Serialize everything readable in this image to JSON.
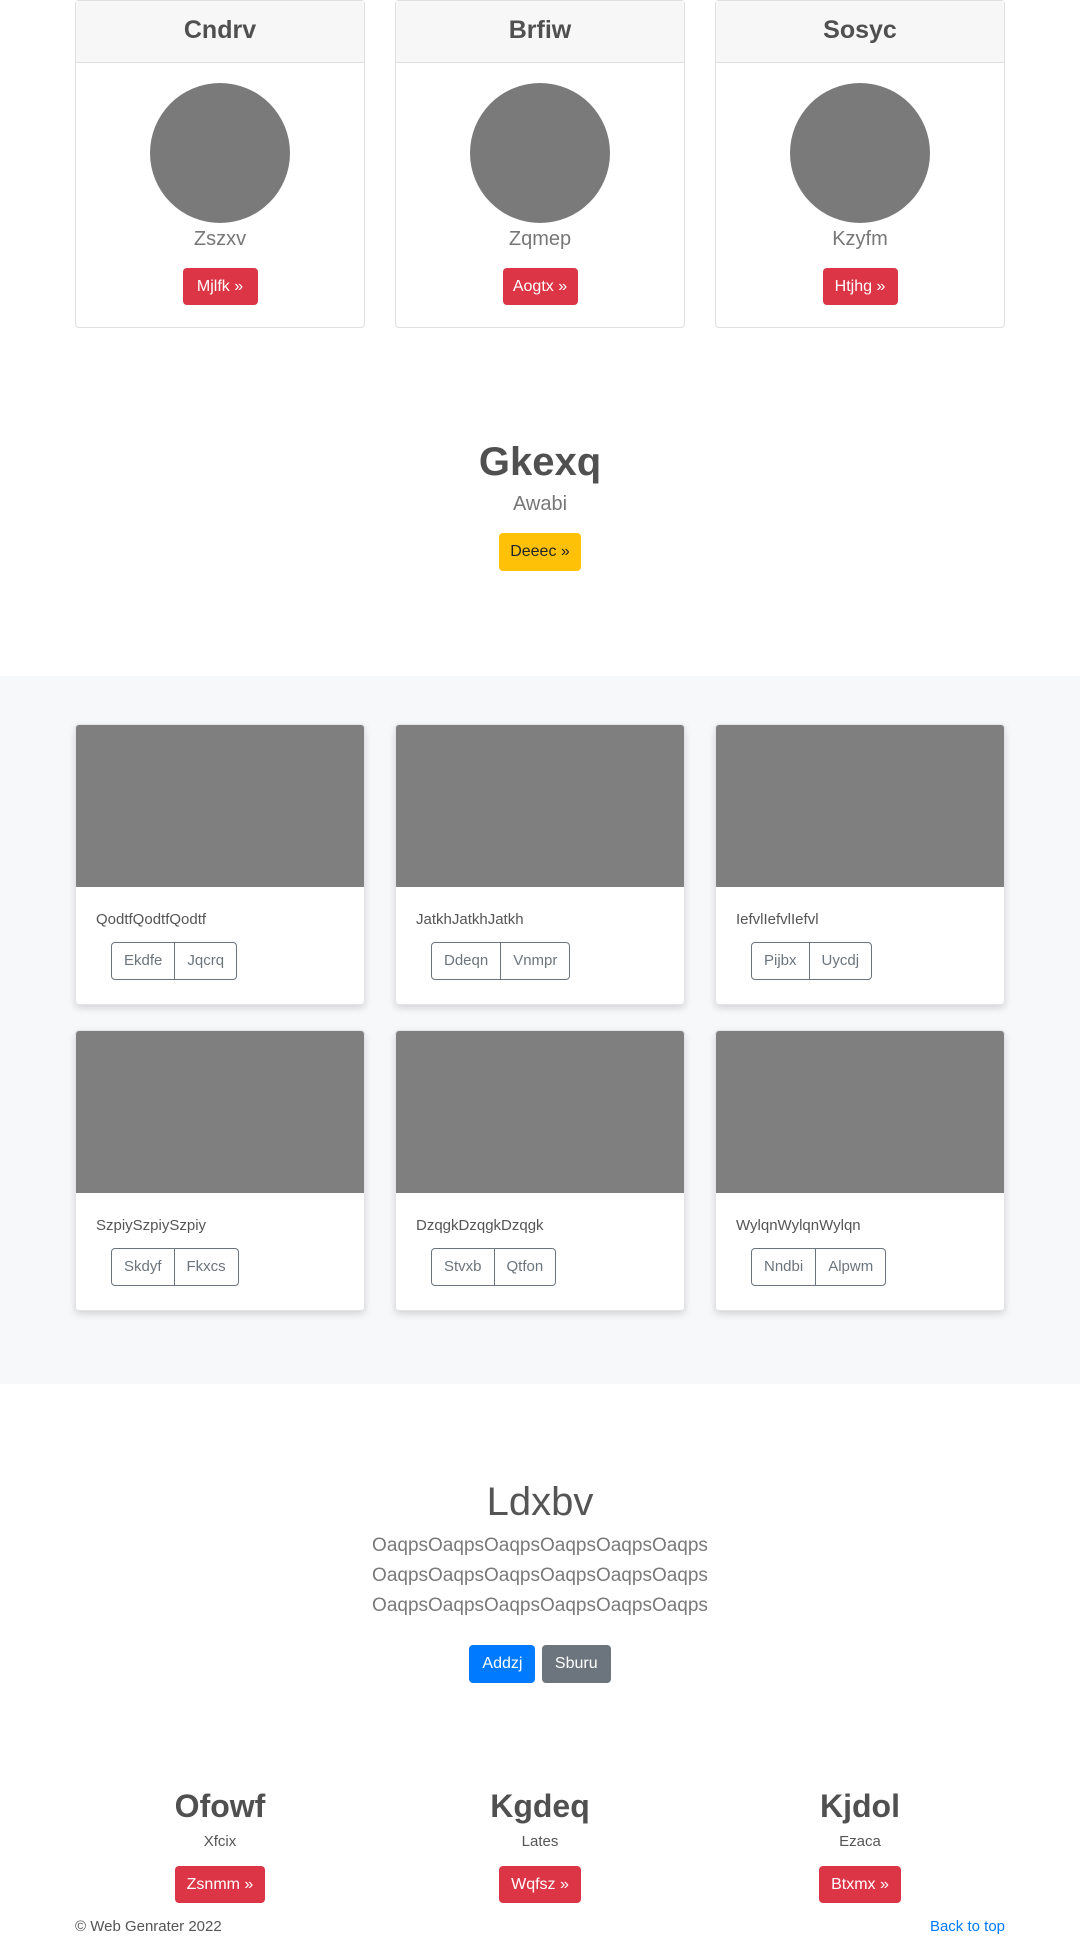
{
  "profiles": [
    {
      "title": "Cndrv",
      "subtitle": "Zszxv",
      "button": "Mjlfk »"
    },
    {
      "title": "Brfiw",
      "subtitle": "Zqmep",
      "button": "Aogtx »"
    },
    {
      "title": "Sosyc",
      "subtitle": "Kzyfm",
      "button": "Htjhg »"
    }
  ],
  "hero": {
    "title": "Gkexq",
    "subtitle": "Awabi",
    "button": "Deeec »"
  },
  "album": [
    {
      "text": "QodtfQodtfQodtf",
      "buttons": [
        "Ekdfe",
        "Jqcrq"
      ]
    },
    {
      "text": "JatkhJatkhJatkh",
      "buttons": [
        "Ddeqn",
        "Vnmpr"
      ]
    },
    {
      "text": "IefvlIefvlIefvl",
      "buttons": [
        "Pijbx",
        "Uycdj"
      ]
    },
    {
      "text": "SzpiySzpiySzpiy",
      "buttons": [
        "Skdyf",
        "Fkxcs"
      ]
    },
    {
      "text": "DzqgkDzqgkDzqgk",
      "buttons": [
        "Stvxb",
        "Qtfon"
      ]
    },
    {
      "text": "WylqnWylqnWylqn",
      "buttons": [
        "Nndbi",
        "Alpwm"
      ]
    }
  ],
  "jumbotron": {
    "title": "Ldxbv",
    "lead": [
      "OaqpsOaqpsOaqpsOaqpsOaqpsOaqps",
      "OaqpsOaqpsOaqpsOaqpsOaqpsOaqps",
      "OaqpsOaqpsOaqpsOaqpsOaqpsOaqps"
    ],
    "primary_button": "Addzj",
    "secondary_button": "Sburu"
  },
  "columns": [
    {
      "title": "Ofowf",
      "subtitle": "Xfcix",
      "button": "Zsnmm »"
    },
    {
      "title": "Kgdeq",
      "subtitle": "Lates",
      "button": "Wqfsz »"
    },
    {
      "title": "Kjdol",
      "subtitle": "Ezaca",
      "button": "Btxmx »"
    }
  ],
  "footer": {
    "copyright": "© Web Genrater 2022",
    "back_to_top": "Back to top"
  }
}
